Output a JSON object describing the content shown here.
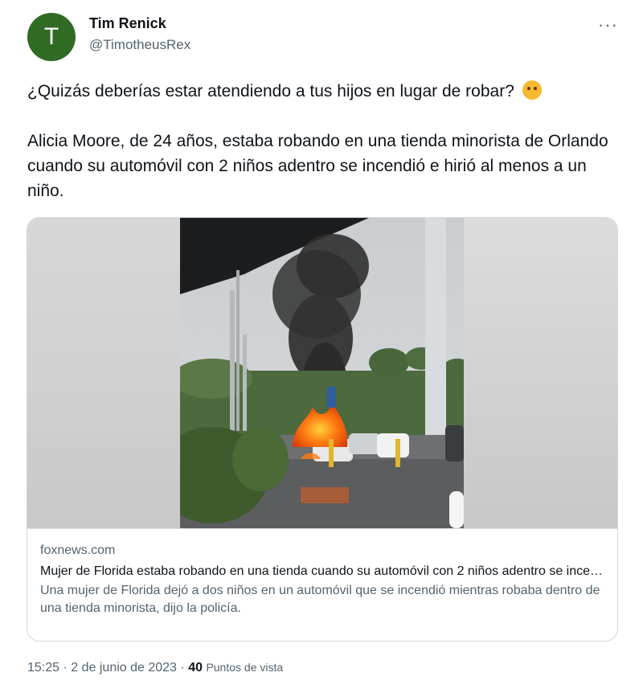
{
  "author": {
    "avatar_letter": "T",
    "avatar_color": "#2f6b22",
    "name": "Tim Renick",
    "handle": "@TimotheusRex"
  },
  "more_icon": "more-horizontal-icon",
  "tweet": {
    "line1": "¿Quizás deberías estar atendiendo a tus hijos en lugar de robar?",
    "emoji": "thinking-face-emoji",
    "line2": "Alicia Moore, de 24 años, estaba robando en una tienda minorista de Orlando cuando su automóvil con 2 niños adentro se incendió e hirió al menos a un niño."
  },
  "link_card": {
    "image": "burning-car-in-parking-lot-photo",
    "domain": "foxnews.com",
    "title": "Mujer de Florida estaba robando en una tienda cuando su automóvil con 2 niños adentro se incendió",
    "description": "Una mujer de Florida dejó a dos niños en un automóvil que se incendió mientras robaba dentro de una tienda minorista, dijo la policía."
  },
  "meta": {
    "time": "15:25",
    "separator": "·",
    "date": "2 de junio de 2023",
    "views_count": "40",
    "views_label": "Puntos de vista"
  }
}
